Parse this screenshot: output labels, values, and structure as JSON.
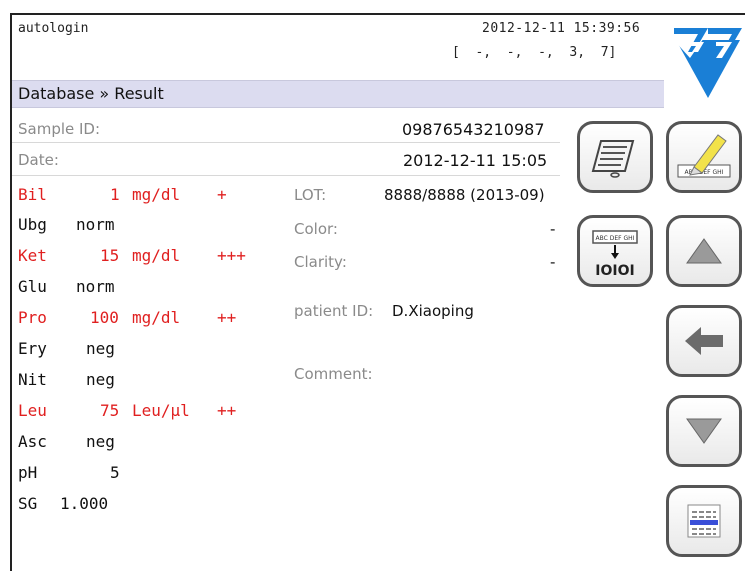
{
  "topbar": {
    "user": "autologin",
    "datetime": "2012-12-11 15:39:56",
    "status": "[  -,  -,  -,  3,  7]"
  },
  "breadcrumb": "Database » Result",
  "sample": {
    "label": "Sample ID:",
    "value": "09876543210987"
  },
  "date": {
    "label": "Date:",
    "value": "2012-12-11 15:05"
  },
  "results": [
    {
      "code": "Bil",
      "value": "1",
      "unit": "mg/dl",
      "flag": "+",
      "abnormal": true
    },
    {
      "code": "Ubg",
      "value": "norm",
      "unit": "",
      "flag": "",
      "abnormal": false
    },
    {
      "code": "Ket",
      "value": "15",
      "unit": "mg/dl",
      "flag": "+++",
      "abnormal": true
    },
    {
      "code": "Glu",
      "value": "norm",
      "unit": "",
      "flag": "",
      "abnormal": false
    },
    {
      "code": "Pro",
      "value": "100",
      "unit": "mg/dl",
      "flag": "++",
      "abnormal": true
    },
    {
      "code": "Ery",
      "value": "neg",
      "unit": "",
      "flag": "",
      "abnormal": false
    },
    {
      "code": "Nit",
      "value": "neg",
      "unit": "",
      "flag": "",
      "abnormal": false
    },
    {
      "code": "Leu",
      "value": "75",
      "unit": "Leu/µl",
      "flag": "++",
      "abnormal": true
    },
    {
      "code": "Asc",
      "value": "neg",
      "unit": "",
      "flag": "",
      "abnormal": false
    },
    {
      "code": "pH",
      "value": "5",
      "unit": "",
      "flag": "",
      "abnormal": false
    },
    {
      "code": "SG",
      "value": "1.000",
      "unit": "",
      "flag": "",
      "abnormal": false
    }
  ],
  "details": {
    "lot_label": "LOT:",
    "lot_value": "8888/8888 (2013-09)",
    "color_label": "Color:",
    "color_value": "-",
    "clarity_label": "Clarity:",
    "clarity_value": "-",
    "patient_label": "patient ID:",
    "patient_value": "D.Xiaoping",
    "comment_label": "Comment:"
  },
  "buttons": {
    "print": "print-icon",
    "edit": "pencil-edit-icon",
    "edit_caption": "ABC DEF GHI",
    "send": "send-to-lis-icon",
    "send_caption_top": "ABC DEF GHI",
    "send_caption_bottom": "IOIOI",
    "up": "arrow-up-icon",
    "back": "arrow-left-icon",
    "down": "arrow-down-icon",
    "list": "list-icon"
  },
  "colors": {
    "abnormal": "#e02020",
    "breadcrumb_bg": "#dcdcf0",
    "logo_blue": "#1a7fd6"
  }
}
